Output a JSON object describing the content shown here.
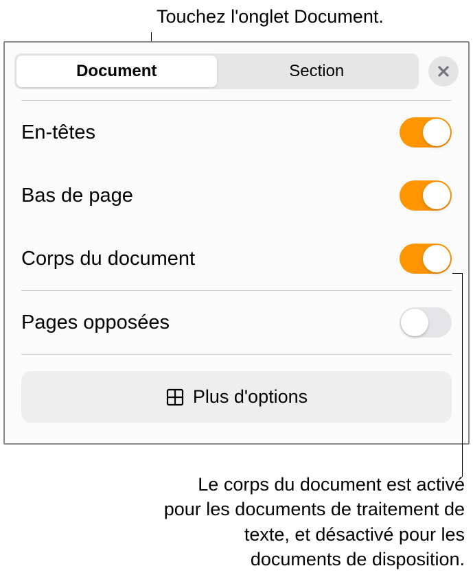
{
  "callout_top": "Touchez l'onglet Document.",
  "tabs": {
    "document": "Document",
    "section": "Section"
  },
  "rows": {
    "headers": "En-têtes",
    "footers": "Bas de page",
    "body": "Corps du document",
    "facing": "Pages opposées"
  },
  "more_options": "Plus d'options",
  "callout_bottom": "Le corps du document est activé pour les documents de traitement de texte, et désactivé pour les documents de disposition."
}
